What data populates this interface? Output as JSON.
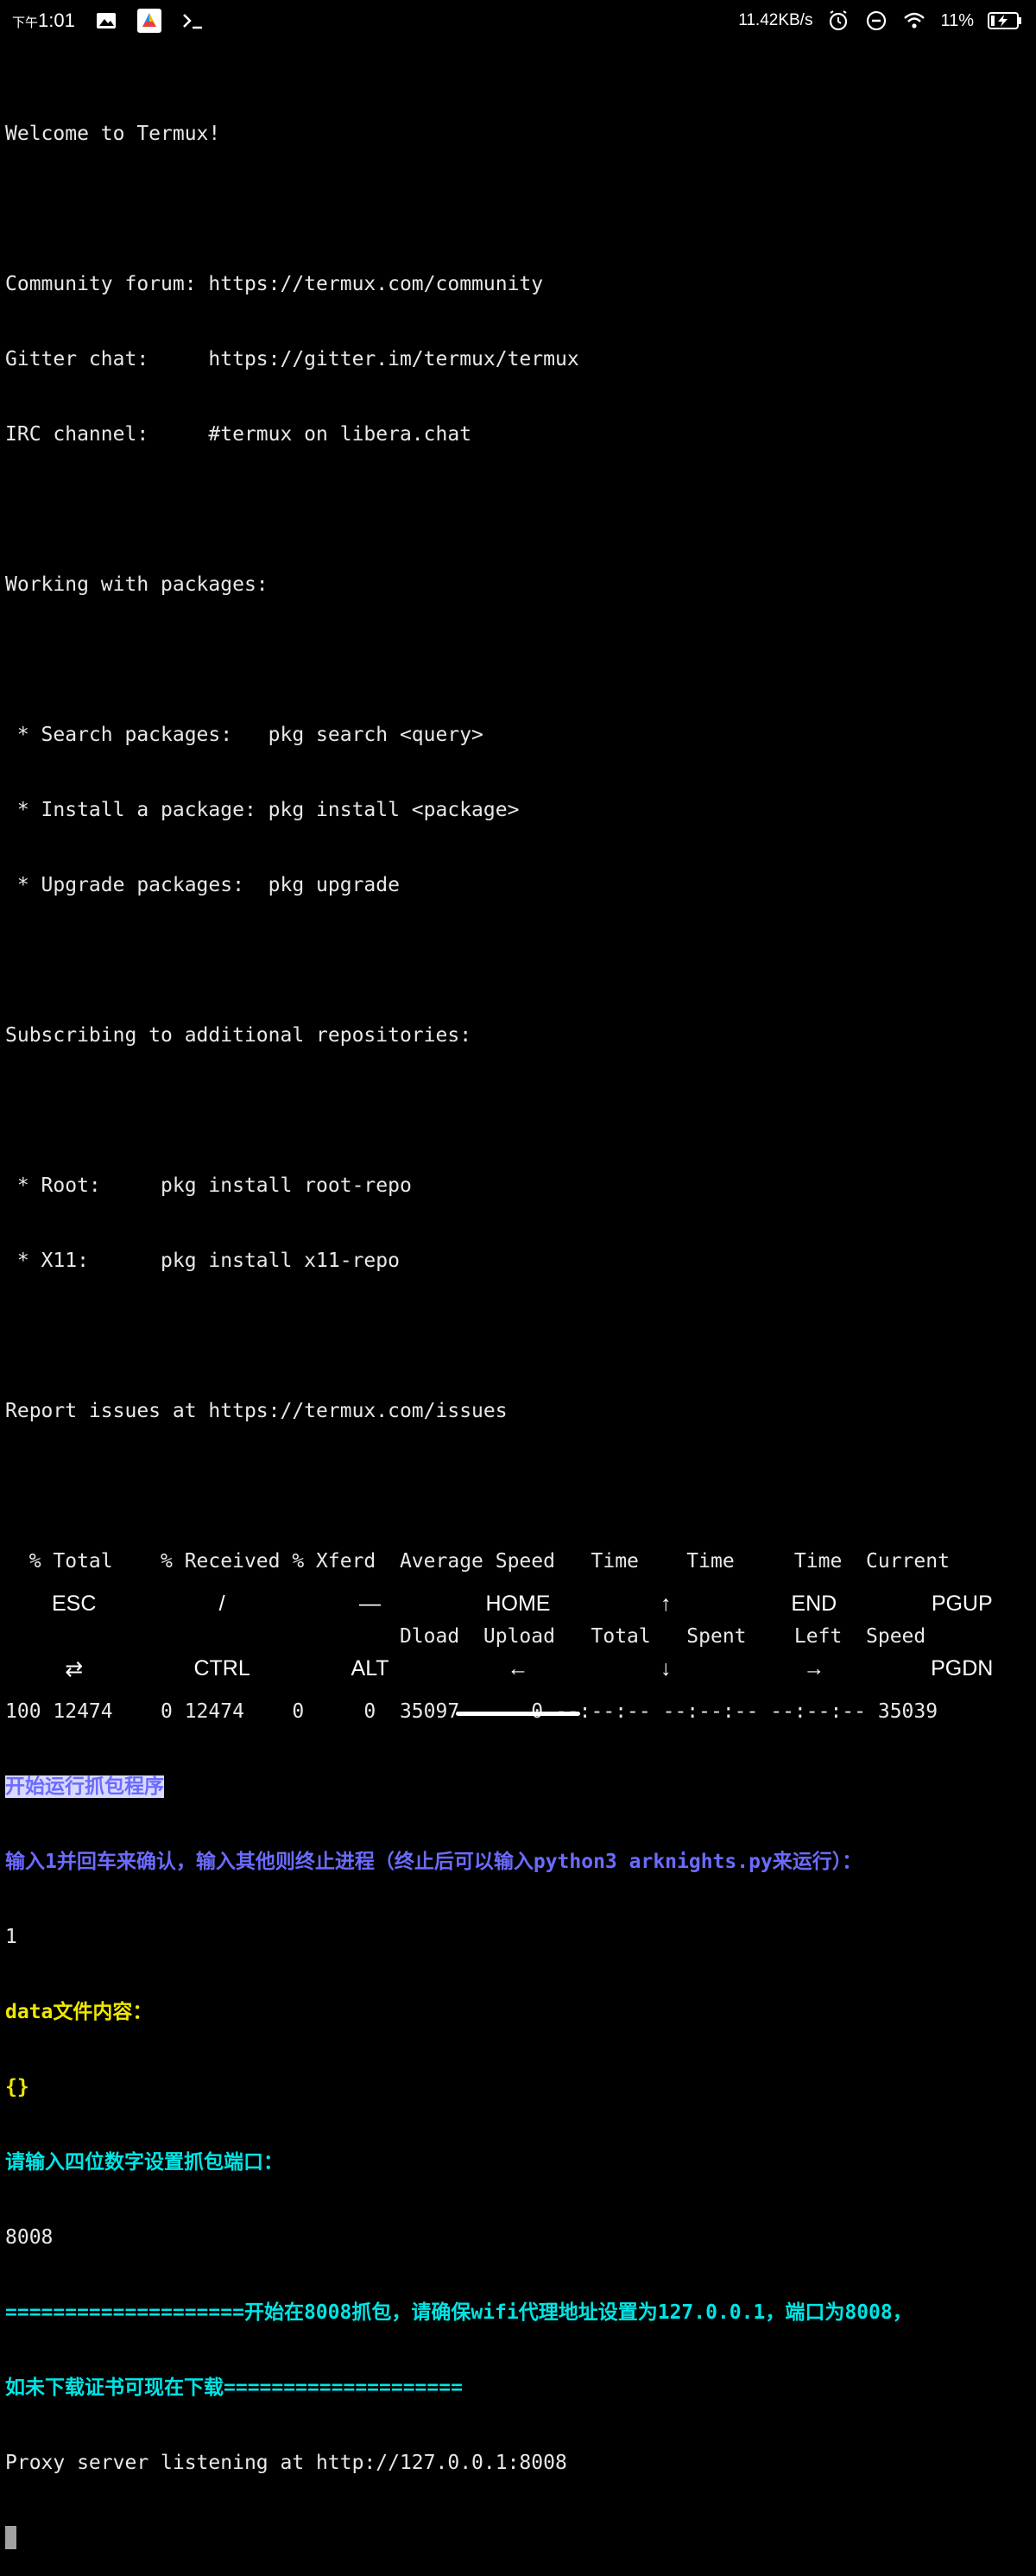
{
  "status_bar": {
    "time_prefix": "下午",
    "time": "1:01",
    "net_speed": "11.42KB/s",
    "battery": "11%",
    "icons": [
      "gallery-icon",
      "app-icon",
      "terminal-icon",
      "alarm-icon",
      "dnd-icon",
      "wifi-icon",
      "battery-charging-icon"
    ]
  },
  "terminal": {
    "lines": [
      "Welcome to Termux!",
      "",
      "Community forum: https://termux.com/community",
      "Gitter chat:     https://gitter.im/termux/termux",
      "IRC channel:     #termux on libera.chat",
      "",
      "Working with packages:",
      "",
      " * Search packages:   pkg search <query>",
      " * Install a package: pkg install <package>",
      " * Upgrade packages:  pkg upgrade",
      "",
      "Subscribing to additional repositories:",
      "",
      " * Root:     pkg install root-repo",
      " * X11:      pkg install x11-repo",
      "",
      "Report issues at https://termux.com/issues",
      "",
      "  % Total    % Received % Xferd  Average Speed   Time    Time     Time  Current",
      "                                 Dload  Upload   Total   Spent    Left  Speed",
      "100 12474    0 12474    0     0  35097      0 --:--:-- --:--:-- --:--:-- 35039"
    ],
    "selected_line": "开始运行抓包程序",
    "confirm_prompt": "输入1并回车来确认，输入其他则终止进程（终止后可以输入python3 arknights.py来运行）：",
    "input_1": "1",
    "data_label": "data文件内容：",
    "data_value": "{}",
    "port_prompt": "请输入四位数字设置抓包端口：",
    "port_input": "8008",
    "notice_line1": "====================开始在8008抓包，请确保wifi代理地址设置为127.0.0.1，端口为8008，",
    "notice_line2": "如未下载证书可现在下载====================",
    "proxy_line": "Proxy server listening at http://127.0.0.1:8008"
  },
  "extra_keys": {
    "row1": [
      "ESC",
      "/",
      "—",
      "HOME",
      "↑",
      "END",
      "PGUP"
    ],
    "row2": [
      "⇄",
      "CTRL",
      "ALT",
      "←",
      "↓",
      "→",
      "PGDN"
    ]
  }
}
